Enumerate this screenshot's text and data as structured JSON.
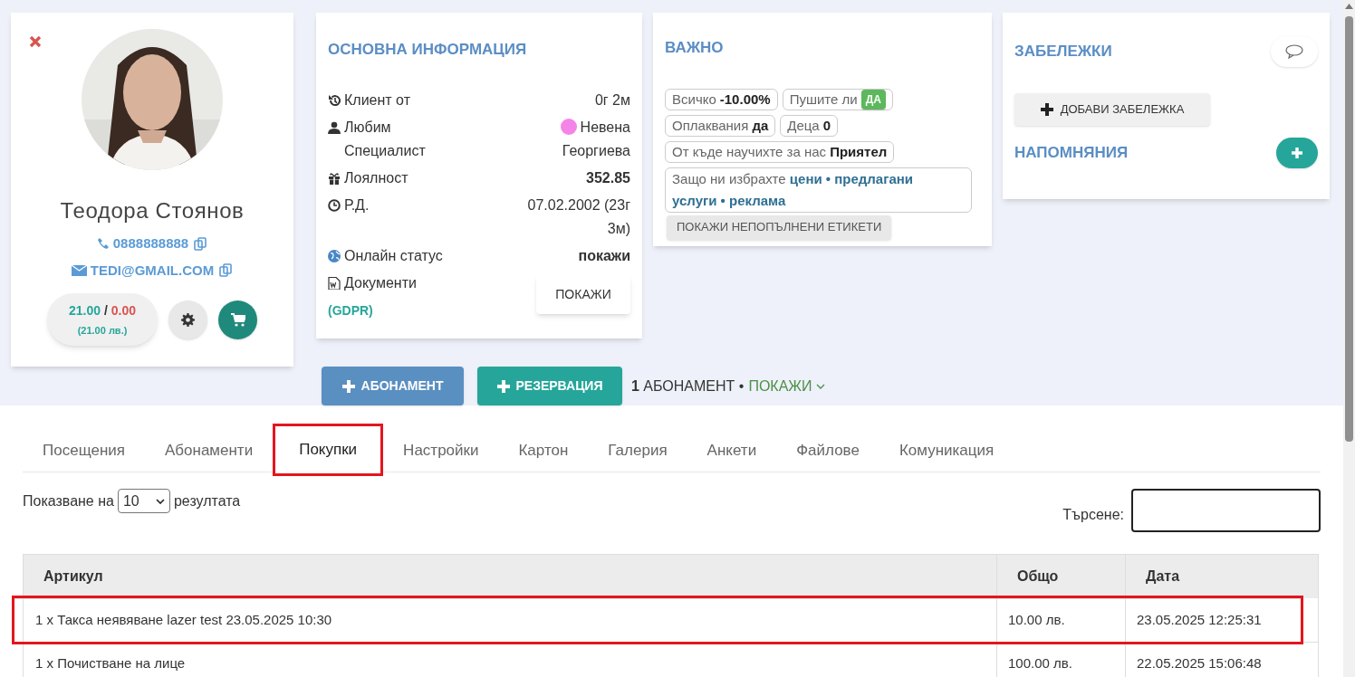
{
  "profile": {
    "name": "Теодора Стоянов",
    "phone": "0888888888",
    "email": "TEDI@GMAIL.COM",
    "balance_paid": "21.00",
    "balance_separator": "/",
    "balance_due": "0.00",
    "balance_total": "(21.00 лв.)"
  },
  "info": {
    "title": "ОСНОВНА ИНФОРМАЦИЯ",
    "rows": [
      {
        "kind": "text",
        "label": "Клиент от",
        "value": "0г 2м"
      },
      {
        "kind": "specialist",
        "label": "Любим Специалист",
        "value": "Невена Георгиева",
        "color": "#f584e8"
      },
      {
        "kind": "bold",
        "label": "Лоялност",
        "value": "352.85"
      },
      {
        "kind": "text",
        "label": "Р.Д.",
        "value": "07.02.2002 (23г 3м)"
      },
      {
        "kind": "bold",
        "label": "Онлайн статус",
        "value": "покажи"
      },
      {
        "kind": "button",
        "label": "Документи",
        "sublabel": "(GDPR)",
        "value": "ПОКАЖИ"
      }
    ]
  },
  "important": {
    "title": "ВАЖНО",
    "tags": [
      {
        "kind": "bold",
        "label": "Всичко",
        "value": "-10.00%"
      },
      {
        "kind": "badge",
        "label": "Пушите ли",
        "value": "ДА"
      },
      {
        "kind": "bold",
        "label": "Оплаквания",
        "value": "да"
      },
      {
        "kind": "bold",
        "label": "Деца",
        "value": "0"
      },
      {
        "kind": "bold",
        "label": "От къде научихте за нас",
        "value": "Приятел"
      },
      {
        "kind": "links",
        "label": "Защо ни избрахте",
        "value": "цени • предлагани услуги • реклама"
      }
    ],
    "button": "ПОКАЖИ НЕПОПЪЛНЕНИ ЕТИКЕТИ"
  },
  "notes": {
    "title": "ЗАБЕЛЕЖКИ",
    "add_button": "ДОБАВИ ЗАБЕЛЕЖКА",
    "reminders_title": "НАПОМНЯНИЯ"
  },
  "actions": {
    "subscription_button": "АБОНАМЕНТ",
    "reservation_button": "РЕЗЕРВАЦИЯ",
    "count": "1",
    "summary": "АБОНАМЕНТ •",
    "show_link": "ПОКАЖИ"
  },
  "tabs": [
    {
      "label": "Посещения",
      "selected": false
    },
    {
      "label": "Абонаменти",
      "selected": false
    },
    {
      "label": "Покупки",
      "selected": true
    },
    {
      "label": "Настройки",
      "selected": false
    },
    {
      "label": "Картон",
      "selected": false
    },
    {
      "label": "Галерия",
      "selected": false
    },
    {
      "label": "Анкети",
      "selected": false
    },
    {
      "label": "Файлове",
      "selected": false
    },
    {
      "label": "Комуникация",
      "selected": false
    }
  ],
  "table": {
    "length_label": "Показване на",
    "length_value": "10",
    "length_suffix": "резултата",
    "search_label": "Търсене:",
    "columns": [
      "Артикул",
      "Общо",
      "Дата"
    ],
    "rows": [
      {
        "cells": [
          "1 x Такса неявяване lazer test 23.05.2025 10:30",
          "10.00 лв.",
          "23.05.2025 12:25:31"
        ],
        "highlighted": true
      },
      {
        "cells": [
          "1 x Почистване на лице",
          "100.00 лв.",
          "22.05.2025 15:06:48"
        ],
        "highlighted": false
      }
    ]
  }
}
